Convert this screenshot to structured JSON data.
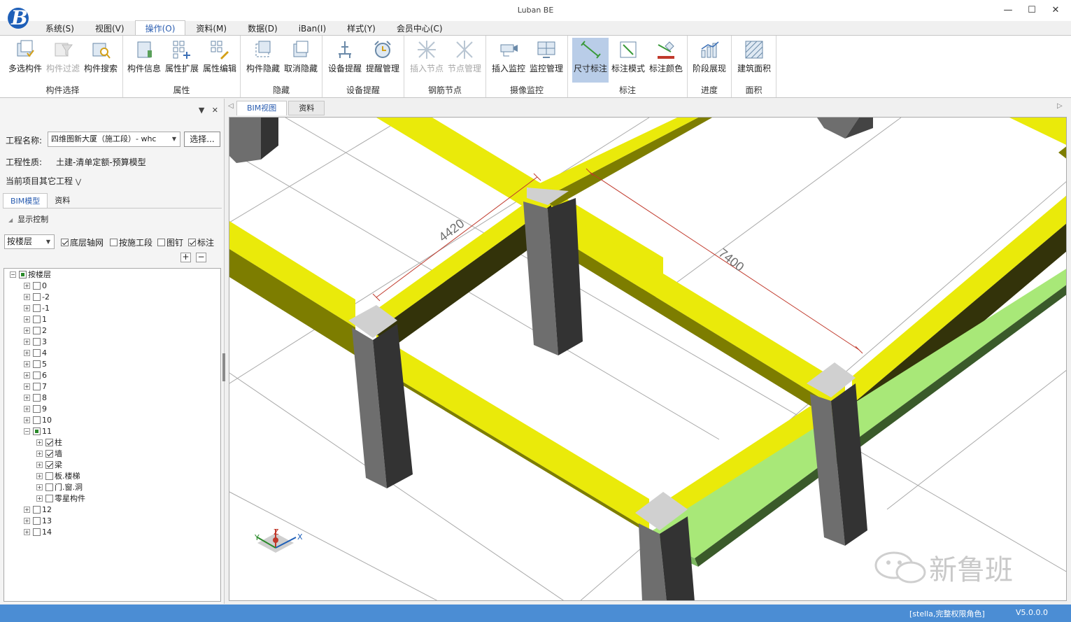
{
  "app": {
    "title": "Luban BE",
    "version": "V5.0.0.0"
  },
  "menus": [
    "系统(S)",
    "视图(V)",
    "操作(O)",
    "资料(M)",
    "数据(D)",
    "iBan(I)",
    "样式(Y)",
    "会员中心(C)"
  ],
  "groups": {
    "select": "构件选择",
    "attr": "属性",
    "hide": "隐藏",
    "device": "设备提醒",
    "rebar": "钢筋节点",
    "camera": "摄像监控",
    "dim": "标注",
    "progress": "进度",
    "area": "面积"
  },
  "buttons": {
    "multi_select": "多选构件",
    "filter": "构件过滤",
    "search": "构件搜索",
    "info": "构件信息",
    "attr_ext": "属性扩展",
    "attr_edit": "属性编辑",
    "hide": "构件隐藏",
    "unhide": "取消隐藏",
    "dev_remind": "设备提醒",
    "remind_mgr": "提醒管理",
    "insert_node": "插入节点",
    "node_mgr": "节点管理",
    "insert_monitor": "插入监控",
    "monitor_mgr": "监控管理",
    "dim_mark": "尺寸标注",
    "dim_mode": "标注模式",
    "dim_color": "标注颜色",
    "stage": "阶段展现",
    "building_area": "建筑面积"
  },
  "panel": {
    "project_label": "工程名称:",
    "project_value": "四维图新大厦（施工段）- whc",
    "select_btn": "选择...",
    "nature_label": "工程性质:",
    "nature_value": "土建-清单定额-预算模型",
    "other_projects": "当前项目其它工程",
    "tabs": [
      "BIM模型",
      "资料"
    ],
    "display_ctrl": "显示控制",
    "floor_combo": "按楼层",
    "chk_axis": "底层轴网",
    "chk_section": "按施工段",
    "chk_pin": "图钉",
    "chk_mark": "标注",
    "plus": "+",
    "minus": "−"
  },
  "tree": {
    "root": "按楼层",
    "floors": [
      "0",
      "-2",
      "-1",
      "1",
      "2",
      "3",
      "4",
      "5",
      "6",
      "7",
      "8",
      "9",
      "10",
      "11"
    ],
    "children": [
      "柱",
      "墙",
      "梁",
      "板.楼梯",
      "门.窗.洞",
      "零星构件"
    ],
    "floors_after": [
      "12",
      "13",
      "14"
    ]
  },
  "view": {
    "tabs": [
      "BIM视图",
      "资料"
    ],
    "dim1": "4420",
    "dim2": "7400",
    "axis_x": "X",
    "axis_y": "Y",
    "axis_z": "Z"
  },
  "status": {
    "user": "[stella,完整权限角色]"
  },
  "watermark": "新鲁班"
}
